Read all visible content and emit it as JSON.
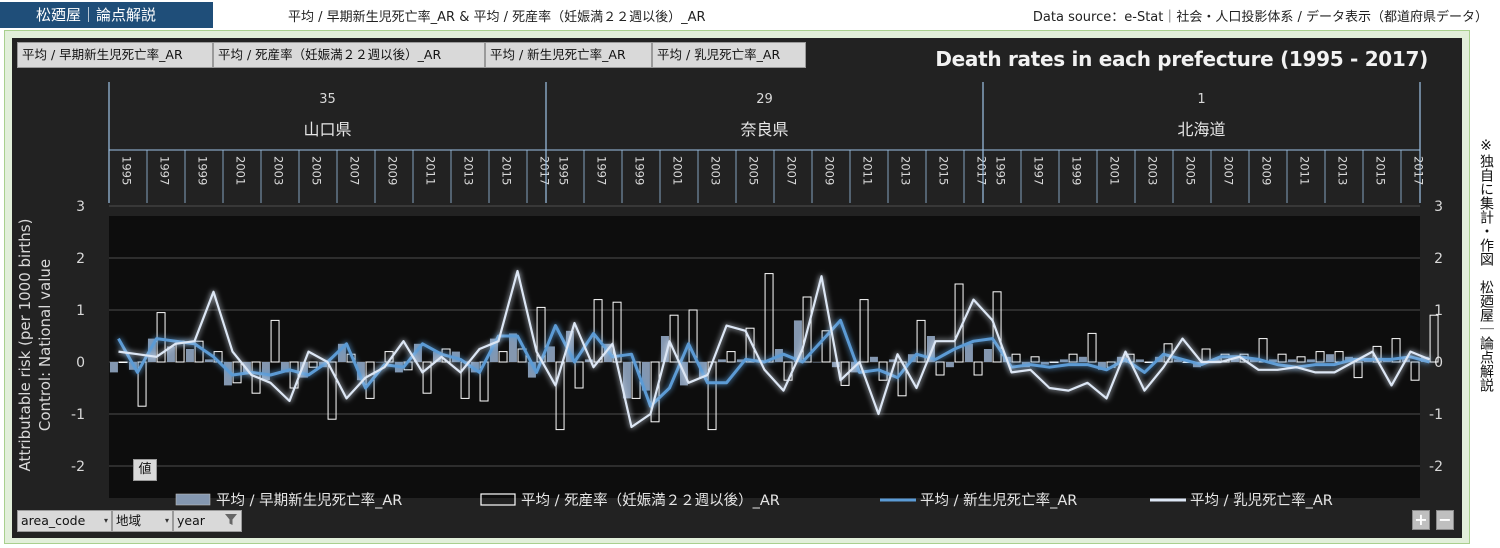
{
  "header": {
    "brand": "松廼屋｜論点解説",
    "headline": "平均 / 早期新生児死亡率_AR & 平均 / 死産率（妊娠満２２週以後）_AR",
    "source": "Data source：e-Stat｜社会・人口投影体系 / データ表示（都道府県データ）"
  },
  "field_buttons": [
    "平均 / 早期新生児死亡率_AR",
    "平均 / 死産率（妊娠満２２週以後）_AR",
    "平均 / 新生児死亡率_AR",
    "平均 / 乳児死亡率_AR"
  ],
  "side_note": "※独自に集計・作図　松廼屋｜論点解説",
  "values_tag": "値",
  "filters": [
    {
      "label": "area_code",
      "icon": "dropdown-arrow-icon"
    },
    {
      "label": "地域",
      "icon": "dropdown-arrow-icon"
    },
    {
      "label": "year",
      "icon": "filter-funnel-icon"
    }
  ],
  "zoom": {
    "plus": "+",
    "minus": "−"
  },
  "colors": {
    "panel": "#222222",
    "bar_fill": "#8497b0",
    "outline_bar": "#ffffff",
    "neonatal": "#5b9bd5",
    "infant": "#dde7f5",
    "axis_line": "#9dc3e6",
    "frame": "#e2efda"
  },
  "chart_data": {
    "type": "bar",
    "title": "Death rates in each prefecture (1995 - 2017)",
    "ylabel_lines": [
      "Attributable risk (per 1000 births)",
      "Control: National value"
    ],
    "ylim": [
      -2,
      3
    ],
    "yticks": [
      -2,
      -1,
      0,
      1,
      2,
      3
    ],
    "groups": [
      {
        "code": "35",
        "name": "山口県",
        "years": [
          1995,
          1996,
          1997,
          1998,
          1999,
          2000,
          2001,
          2002,
          2003,
          2004,
          2005,
          2006,
          2007,
          2008,
          2009,
          2010,
          2011,
          2012,
          2013,
          2014,
          2015,
          2016,
          2017
        ]
      },
      {
        "code": "29",
        "name": "奈良県",
        "years": [
          1995,
          1996,
          1997,
          1998,
          1999,
          2000,
          2001,
          2002,
          2003,
          2004,
          2005,
          2006,
          2007,
          2008,
          2009,
          2010,
          2011,
          2012,
          2013,
          2014,
          2015,
          2016,
          2017
        ]
      },
      {
        "code": "1",
        "name": "北海道",
        "years": [
          1995,
          1996,
          1997,
          1998,
          1999,
          2000,
          2001,
          2002,
          2003,
          2004,
          2005,
          2006,
          2007,
          2008,
          2009,
          2010,
          2011,
          2012,
          2013,
          2014,
          2015,
          2016,
          2017
        ]
      }
    ],
    "series": [
      {
        "name": "平均 / 早期新生児死亡率_AR",
        "kind": "bar-filled",
        "values": [
          -0.2,
          -0.15,
          0.45,
          0.3,
          0.25,
          0.05,
          -0.45,
          -0.2,
          -0.35,
          -0.2,
          -0.3,
          -0.1,
          0.35,
          -0.35,
          0.0,
          -0.2,
          0.35,
          0.2,
          0.2,
          -0.2,
          0.45,
          0.55,
          -0.3,
          0.3,
          0.6,
          0.05,
          0.35,
          -0.7,
          -0.55,
          0.5,
          -0.45,
          -0.3,
          0.05,
          0.05,
          0.0,
          0.25,
          0.8,
          0.0,
          -0.1,
          -0.2,
          0.1,
          0.05,
          0.15,
          0.5,
          -0.1,
          0.35,
          0.25,
          0.1,
          -0.1,
          -0.05,
          0.05,
          0.1,
          -0.15,
          0.1,
          0.05,
          0.1,
          0.05,
          -0.1,
          0.05,
          0.1,
          0.05,
          0.05,
          0.05,
          0.05,
          0.15,
          0.1,
          0.05,
          0.05,
          0.05,
          0.1
        ]
      },
      {
        "name": "平均 / 死産率（妊娠満２２週以後）_AR",
        "kind": "bar-outline",
        "values": [
          0.0,
          -0.85,
          0.95,
          0.4,
          0.4,
          0.2,
          -0.4,
          -0.6,
          0.8,
          -0.5,
          -0.1,
          -1.1,
          0.15,
          -0.7,
          0.2,
          -0.15,
          -0.6,
          0.25,
          -0.7,
          -0.75,
          0.2,
          0.25,
          1.05,
          -1.3,
          -0.5,
          1.2,
          1.15,
          -0.7,
          -1.15,
          0.9,
          1.0,
          -1.3,
          0.2,
          0.65,
          1.7,
          -0.35,
          1.25,
          0.6,
          -0.45,
          1.2,
          -0.35,
          -0.65,
          0.8,
          -0.25,
          1.5,
          -0.25,
          1.35,
          0.15,
          0.1,
          0.0,
          0.15,
          0.55,
          -0.1,
          0.15,
          0.0,
          0.35,
          0.0,
          0.25,
          0.15,
          0.15,
          0.45,
          0.15,
          0.1,
          0.2,
          0.2,
          -0.3,
          0.3,
          0.45,
          -0.35,
          0.9
        ]
      },
      {
        "name": "平均 / 新生児死亡率_AR",
        "kind": "line",
        "values": [
          0.45,
          -0.2,
          0.45,
          0.4,
          0.35,
          0.1,
          -0.25,
          -0.2,
          -0.25,
          -0.15,
          -0.25,
          0.0,
          0.35,
          -0.5,
          -0.05,
          -0.1,
          0.35,
          0.15,
          0.05,
          -0.2,
          0.5,
          0.5,
          -0.2,
          0.7,
          0.0,
          0.55,
          0.1,
          0.15,
          -0.85,
          -0.5,
          0.35,
          -0.4,
          -0.4,
          0.05,
          0.0,
          0.15,
          0.0,
          0.4,
          0.8,
          -0.2,
          -0.15,
          -0.3,
          0.15,
          0.05,
          0.25,
          0.4,
          0.45,
          -0.1,
          -0.05,
          -0.1,
          -0.05,
          -0.05,
          -0.15,
          0.05,
          -0.2,
          0.15,
          0.05,
          -0.05,
          0.1,
          0.1,
          0.05,
          -0.05,
          -0.1,
          -0.05,
          -0.05,
          0.05,
          0.05,
          0.05,
          0.1,
          0.0
        ]
      },
      {
        "name": "平均 / 乳児死亡率_AR",
        "kind": "line",
        "values": [
          0.2,
          0.15,
          0.1,
          0.35,
          0.4,
          1.35,
          0.2,
          -0.25,
          -0.4,
          -0.75,
          0.2,
          0.0,
          -0.7,
          -0.3,
          -0.1,
          0.4,
          -0.2,
          0.1,
          -0.2,
          0.25,
          0.4,
          1.75,
          0.2,
          -0.45,
          0.75,
          -0.1,
          0.35,
          -1.25,
          -1.0,
          0.4,
          -0.4,
          -0.25,
          0.7,
          0.6,
          -0.15,
          -0.55,
          0.25,
          1.65,
          -0.35,
          0.0,
          -1.0,
          0.15,
          -0.5,
          0.4,
          0.4,
          1.2,
          0.8,
          -0.2,
          -0.15,
          -0.5,
          -0.55,
          -0.4,
          -0.7,
          0.2,
          -0.55,
          -0.1,
          0.45,
          0.0,
          0.0,
          0.1,
          -0.15,
          -0.15,
          -0.1,
          -0.2,
          -0.2,
          0.0,
          0.2,
          -0.45,
          0.2,
          0.05
        ]
      }
    ],
    "legend_position": "bottom",
    "grid": true
  }
}
